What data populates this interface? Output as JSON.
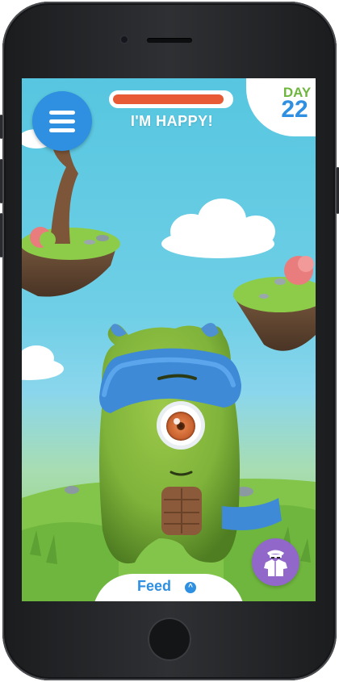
{
  "hud": {
    "mood_text": "I'M HAPPY!",
    "health_fraction": 0.95,
    "day_label": "DAY",
    "day_number": "22"
  },
  "bottom_bar": {
    "feed_label": "Feed",
    "feed_arrow": "^"
  },
  "icons": {
    "menu": "hamburger-menu-icon",
    "wardrobe": "shirt-hat-icon",
    "feed_arrow": "chevron-up-icon"
  },
  "colors": {
    "accent_blue": "#2f8fe0",
    "health_red": "#e85a35",
    "day_green": "#6fb63e",
    "wardrobe_purple": "#9168c9",
    "creature_green": "#7fb33a"
  }
}
